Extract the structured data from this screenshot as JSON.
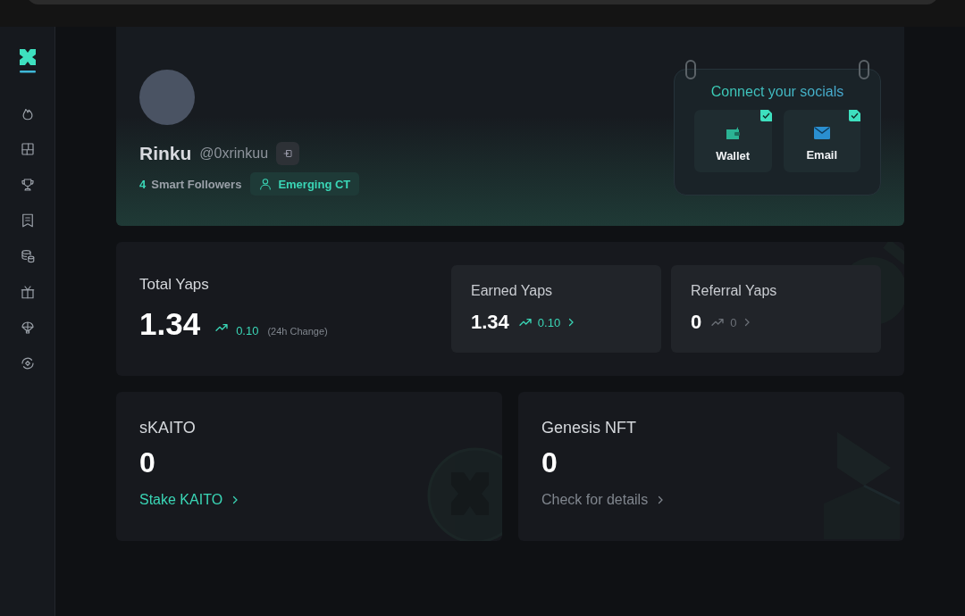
{
  "profile": {
    "name": "Rinku",
    "handle": "@0xrinkuu",
    "followers_count": "4",
    "followers_label": "Smart Followers",
    "badge": "Emerging CT"
  },
  "socials": {
    "title": "Connect your socials",
    "items": [
      {
        "label": "Wallet",
        "kind": "wallet",
        "connected": true
      },
      {
        "label": "Email",
        "kind": "email",
        "connected": true
      }
    ]
  },
  "total_yaps": {
    "label": "Total Yaps",
    "value": "1.34",
    "change": "0.10",
    "change_note": "(24h Change)"
  },
  "yap_cards": [
    {
      "label": "Earned Yaps",
      "value": "1.34",
      "change": "0.10",
      "positive": true
    },
    {
      "label": "Referral Yaps",
      "value": "0",
      "change": "0",
      "positive": false
    }
  ],
  "bottom_cards": [
    {
      "label": "sKAITO",
      "value": "0",
      "link": "Stake KAITO",
      "highlighted": true,
      "kind": "coin"
    },
    {
      "label": "Genesis NFT",
      "value": "0",
      "link": "Check for details",
      "highlighted": false,
      "kind": "box"
    }
  ]
}
